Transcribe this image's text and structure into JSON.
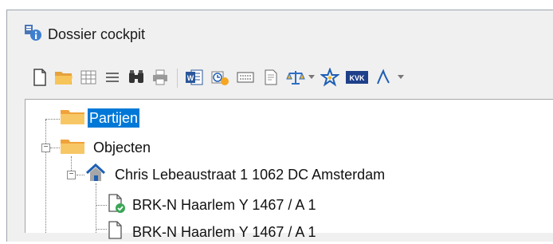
{
  "window": {
    "title": "Dossier cockpit"
  },
  "toolbar": {
    "buttons": [
      {
        "icon": "new-document-icon"
      },
      {
        "icon": "open-folder-icon"
      },
      {
        "icon": "grid-icon"
      },
      {
        "icon": "list-icon"
      },
      {
        "icon": "binoculars-icon"
      },
      {
        "icon": "print-icon"
      },
      {
        "icon": "word-icon"
      },
      {
        "icon": "clock-icon"
      },
      {
        "icon": "keyboard-icon"
      },
      {
        "icon": "document-seal-icon"
      },
      {
        "icon": "scales-icon"
      },
      {
        "icon": "star-icon"
      },
      {
        "icon": "kvk-icon",
        "text": "KVK"
      },
      {
        "icon": "signature-icon"
      }
    ]
  },
  "tree": {
    "nodes": [
      {
        "label": "Partijen",
        "selected": true
      },
      {
        "label": "Objecten"
      },
      {
        "label": "Chris Lebeaustraat 1 1062 DC Amsterdam"
      },
      {
        "label": "BRK-N Haarlem Y 1467 / A 1"
      },
      {
        "label": "BRK-N Haarlem Y 1467 / A 1"
      }
    ]
  },
  "colors": {
    "selection": "#0078d7",
    "folder": "#f5b94a",
    "accent_blue": "#1e5fb4"
  }
}
